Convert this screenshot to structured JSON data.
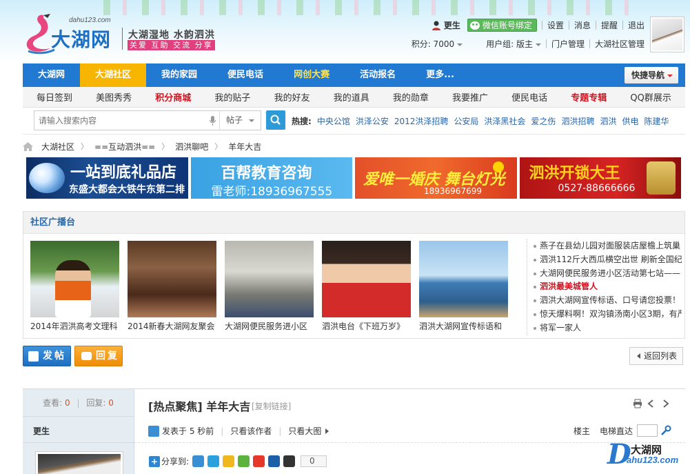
{
  "colors": {
    "brand_blue": "#2179d1",
    "nav_active": "#f7b500",
    "accent_red": "#d4111e",
    "link_blue": "#2964a6",
    "logo_pink": "#e0417e"
  },
  "header": {
    "logo_domain": "dahu123.com",
    "logo_text": "大湖网",
    "slogan_main": "大湖湿地 水韵泗洪",
    "slogan_sub": "关爱 互助 交流 分享",
    "username": "更生",
    "wechat_bind": "微信账号绑定",
    "links": [
      "设置",
      "消息",
      "提醒",
      "退出"
    ],
    "points": "积分: 7000",
    "usergroup": "用户组: 版主",
    "admin_links": [
      "门户管理",
      "大湖社区管理"
    ]
  },
  "mainnav": {
    "items": [
      "大湖网",
      "大湖社区",
      "我的家园",
      "便民电话",
      "网创大赛",
      "活动报名",
      "更多..."
    ],
    "quick_nav": "快捷导航"
  },
  "subnav": {
    "items": [
      "每日签到",
      "美图秀秀",
      "积分商城",
      "我的贴子",
      "我的好友",
      "我的道具",
      "我的勋章",
      "我要推广",
      "便民电话",
      "专题专辑",
      "QQ群展示"
    ]
  },
  "search": {
    "placeholder": "请输入搜索内容",
    "type": "帖子",
    "hot_label": "热搜:",
    "hot_keywords": [
      "中央公馆",
      "洪泽公安",
      "2012洪泽招聘",
      "公安局",
      "洪泽黑社会",
      "爱之伤",
      "泗洪招聘",
      "泗洪",
      "供电",
      "陈建华"
    ]
  },
  "breadcrumb": [
    "大湖社区",
    "==互动泗洪==",
    "泗洪聊吧",
    "羊年大吉"
  ],
  "ads": [
    {
      "line1": "一站到底礼品店",
      "line2": "东盛大都会大铁牛东第二排"
    },
    {
      "line1": "百帮教育咨询",
      "line2": "雷老师:18936967555"
    },
    {
      "line1": "爱唯一婚庆 舞台灯光",
      "line2": "18936967699"
    },
    {
      "line1": "泗洪开锁大王",
      "line2": "0527-88666666"
    }
  ],
  "broadcast": {
    "title": "社区广播台",
    "thumbs": [
      "2014年泗洪高考文理科",
      "2014新春大湖网友聚会",
      "大湖网便民服务进小区",
      "泗洪电台《下班万岁》",
      "泗洪大湖网宣传标语和"
    ],
    "news": [
      "燕子在县幼儿园对面服装店屋檐上筑巢",
      "泗洪112斤大西瓜横空出世 刷新全国纪",
      "大湖网便民服务进小区活动第七站——",
      "泗洪最美城管人",
      "泗洪大湖网宣传标语、口号请您投票！",
      "惊天爆料啊！双沟镇汤南小区3期，有严",
      "将军一家人"
    ]
  },
  "actions": {
    "post": "发帖",
    "reply": "回复",
    "back": "返回列表"
  },
  "thread": {
    "views_label": "查看:",
    "views": "0",
    "replies_label": "回复:",
    "replies": "0",
    "category": "[热点聚焦]",
    "title": "羊年大吉",
    "copy_link": "[复制链接]",
    "author": "更生",
    "posted": "发表于 5 秒前",
    "only_author": "只看该作者",
    "big_image": "只看大图",
    "floor": "楼主",
    "elevator": "电梯直达",
    "share_label": "分享到:",
    "share_count": "0"
  },
  "watermark": {
    "letter": "D",
    "title": "大湖网",
    "domain": "ahu123.com"
  }
}
